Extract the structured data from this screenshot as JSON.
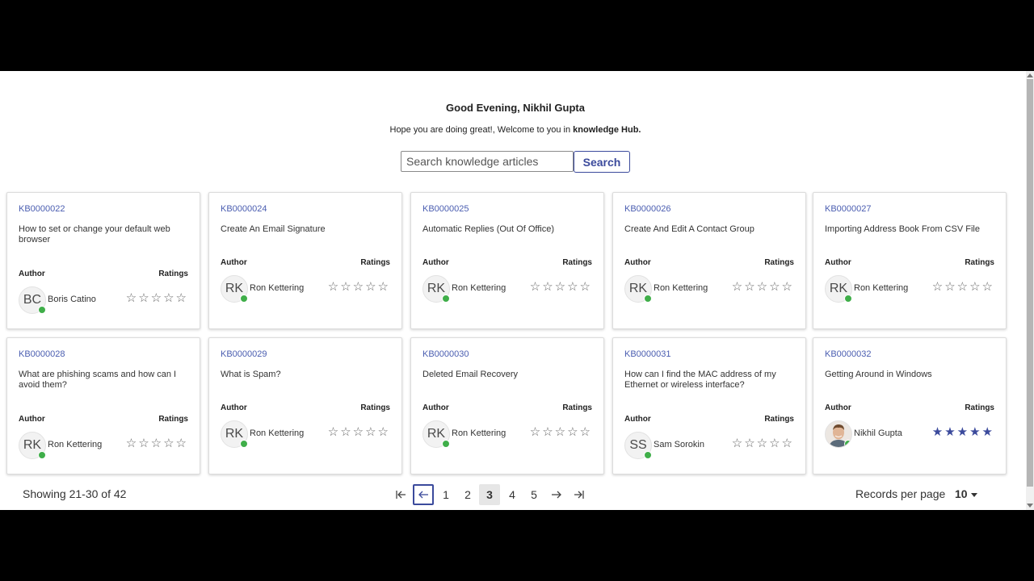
{
  "header": {
    "greeting": "Good Evening, Nikhil Gupta",
    "welcome_prefix": "Hope you are doing great!, Welcome to you in ",
    "welcome_bold": "knowledge Hub."
  },
  "search": {
    "placeholder": "Search knowledge articles",
    "value": "",
    "button_label": "Search"
  },
  "labels": {
    "author": "Author",
    "ratings": "Ratings"
  },
  "colors": {
    "accent": "#3b4a9c",
    "link": "#4a5db0",
    "presence": "#3fae49"
  },
  "cards": [
    {
      "id": "KB0000022",
      "title": "How to set or change your default web browser",
      "author": "Boris Catino",
      "initials": "BC",
      "rating": 0,
      "avatar": "initials"
    },
    {
      "id": "KB0000024",
      "title": "Create An Email Signature",
      "author": "Ron Kettering",
      "initials": "RK",
      "rating": 0,
      "avatar": "initials"
    },
    {
      "id": "KB0000025",
      "title": "Automatic Replies (Out Of Office)",
      "author": "Ron Kettering",
      "initials": "RK",
      "rating": 0,
      "avatar": "initials"
    },
    {
      "id": "KB0000026",
      "title": "Create And Edit A Contact Group",
      "author": "Ron Kettering",
      "initials": "RK",
      "rating": 0,
      "avatar": "initials"
    },
    {
      "id": "KB0000027",
      "title": "Importing Address Book From CSV File",
      "author": "Ron Kettering",
      "initials": "RK",
      "rating": 0,
      "avatar": "initials"
    },
    {
      "id": "KB0000028",
      "title": "What are phishing scams and how can I avoid them?",
      "author": "Ron Kettering",
      "initials": "RK",
      "rating": 0,
      "avatar": "initials"
    },
    {
      "id": "KB0000029",
      "title": "What is Spam?",
      "author": "Ron Kettering",
      "initials": "RK",
      "rating": 0,
      "avatar": "initials"
    },
    {
      "id": "KB0000030",
      "title": "Deleted Email Recovery",
      "author": "Ron Kettering",
      "initials": "RK",
      "rating": 0,
      "avatar": "initials"
    },
    {
      "id": "KB0000031",
      "title": "How can I find the MAC address of my Ethernet or wireless interface?",
      "author": "Sam Sorokin",
      "initials": "SS",
      "rating": 0,
      "avatar": "initials"
    },
    {
      "id": "KB0000032",
      "title": "Getting Around in Windows",
      "author": "Nikhil Gupta",
      "initials": "",
      "rating": 5,
      "avatar": "photo"
    }
  ],
  "pagination": {
    "showing": "Showing 21-30 of 42",
    "pages": [
      "1",
      "2",
      "3",
      "4",
      "5"
    ],
    "current_page": "3",
    "records_label": "Records per page",
    "records_value": "10"
  }
}
